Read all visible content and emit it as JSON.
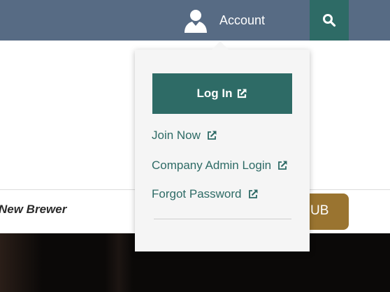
{
  "header": {
    "account_label": "Account",
    "account_icon": "user-icon",
    "search_icon": "search-icon",
    "bar_color": "#576b84",
    "search_color": "#2e6b66"
  },
  "dropdown": {
    "login_label": "Log In",
    "links": [
      {
        "label": "Join Now",
        "icon": "external-link-icon"
      },
      {
        "label": "Company Admin Login",
        "icon": "external-link-icon"
      },
      {
        "label": "Forgot Password",
        "icon": "external-link-icon"
      }
    ]
  },
  "page": {
    "brewer_text": "New Brewer",
    "club_button_text": "UB",
    "club_button_color": "#9a7430"
  }
}
